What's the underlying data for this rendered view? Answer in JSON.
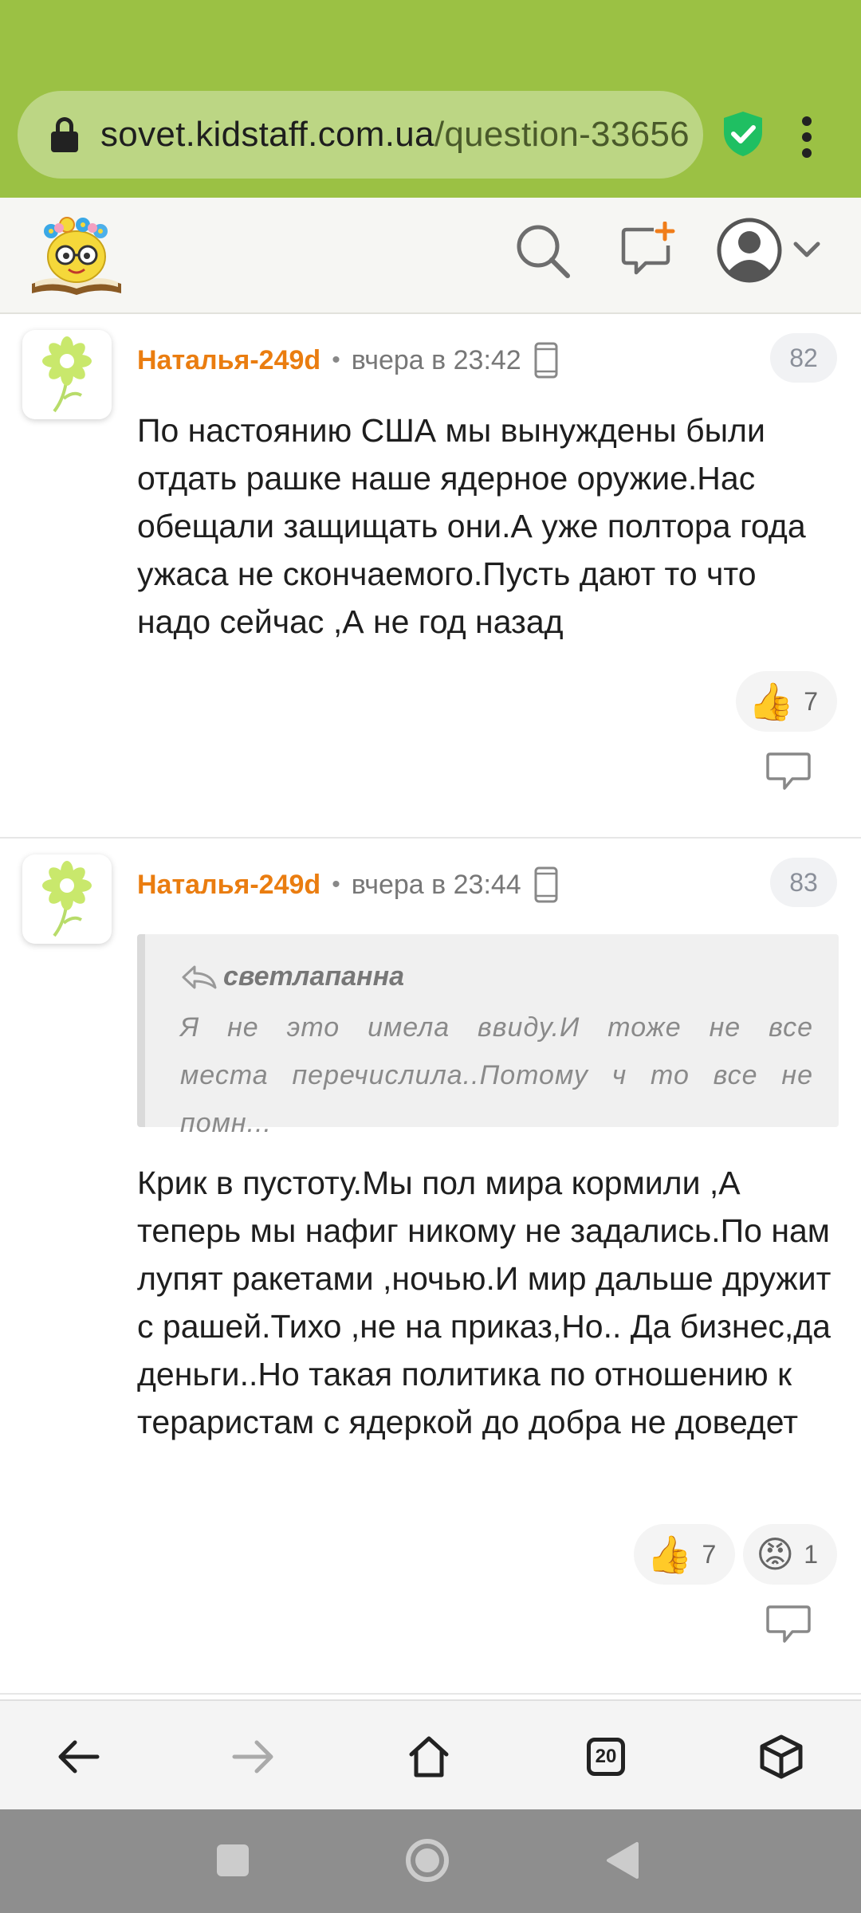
{
  "browser": {
    "url_host": "sovet.kidstaff.com.ua",
    "url_path": "/question-33656",
    "tabs_count": "20"
  },
  "site": {
    "logo": "kidstaff-logo",
    "colors": {
      "accent": "#ea7d10",
      "brand_bar": "#9bc144"
    }
  },
  "comments": [
    {
      "author": "Наталья-249d",
      "separator": "•",
      "time": "вчера в 23:42",
      "number": "82",
      "text": "По настоянию США мы вынуждены были отдать рашке наше ядерное оружие.Нас обещали защищать они.А уже полтора года ужаса не скончаемого.Пусть дают то что надо сейчас ,А не год назад",
      "reactions": [
        {
          "icon": "thumbs-up-icon",
          "emoji": "👍",
          "count": "7"
        }
      ]
    },
    {
      "author": "Наталья-249d",
      "separator": "•",
      "time": "вчера в 23:44",
      "number": "83",
      "quote": {
        "author": "светлапанна",
        "text": "Я не это имела ввиду.И тоже не все места перечислила..Потому ч то все не помн..."
      },
      "text": "Крик в пустоту.Мы пол мира кормили ,А теперь мы нафиг никому не задались.По нам лупят ракетами ,ночью.И мир дальше дружит с рашей.Тихо ,не на приказ,Но.. Да бизнес,да деньги..Но такая политика по отношению к тераристам с ядеркой до добра не доведет",
      "reactions": [
        {
          "icon": "thumbs-up-icon",
          "emoji": "👍",
          "count": "7"
        },
        {
          "icon": "angry-face-icon",
          "emoji": "😡",
          "count": "1"
        }
      ]
    }
  ]
}
